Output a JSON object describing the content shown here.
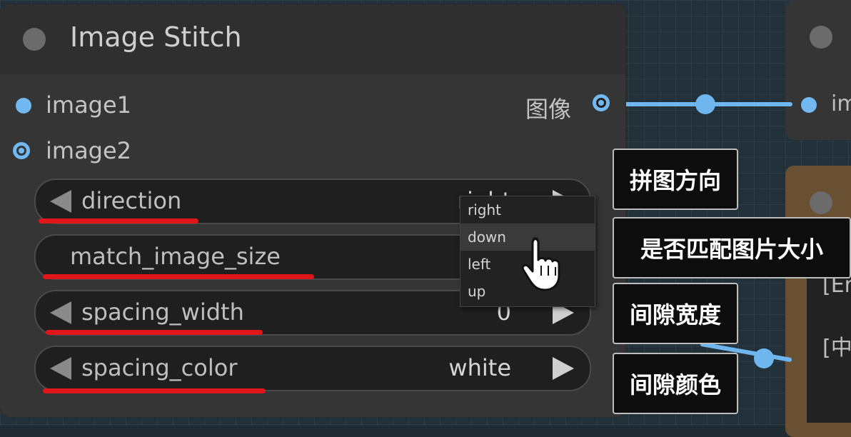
{
  "node": {
    "title": "Image Stitch",
    "inputs": [
      "image1",
      "image2"
    ],
    "output": "图像"
  },
  "widgets": {
    "direction": {
      "label": "direction",
      "value": "right"
    },
    "match_image_size": {
      "label": "match_image_size"
    },
    "spacing_width": {
      "label": "spacing_width",
      "value": "0"
    },
    "spacing_color": {
      "label": "spacing_color",
      "value": "white"
    }
  },
  "dropdown": {
    "options": [
      "right",
      "down",
      "left",
      "up"
    ],
    "hovered": "down"
  },
  "annotations": [
    "拼图方向",
    "是否匹配图片大小",
    "间隙宽度",
    "间隙颜色"
  ],
  "background": {
    "right_node_input": "im",
    "right_text_1": "[Er",
    "right_text_2": "[中"
  },
  "colors": {
    "wire": "#6fb6ee",
    "underline": "#e0161a",
    "node_bg": "#353535"
  }
}
